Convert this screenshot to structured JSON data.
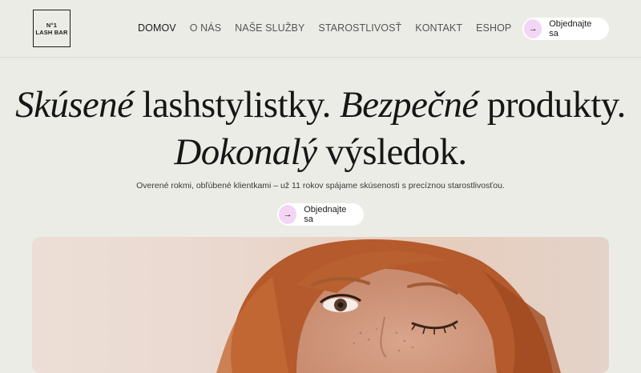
{
  "logo": {
    "line1": "N°1",
    "line2": "LASH BAR"
  },
  "nav": {
    "items": [
      {
        "label": "DOMOV",
        "active": true
      },
      {
        "label": "O NÁS"
      },
      {
        "label": "NAŠE SLUŽBY"
      },
      {
        "label": "STAROSTLIVOSŤ"
      },
      {
        "label": "KONTAKT"
      },
      {
        "label": "ESHOP"
      }
    ]
  },
  "cta": {
    "label": "Objednajte sa",
    "icon": "arrow-right-icon"
  },
  "hero": {
    "headline": {
      "w1": "Skúsené",
      "t1": " lashstylistky. ",
      "w2": "Bezpečné",
      "t2": " produkty.",
      "w3": "Dokonalý",
      "t3": " výsledok."
    },
    "subtitle": "Overené rokmi, obľúbené klientkami – už 11 rokov spájame skúsenosti s precíznou starostlivosťou.",
    "cta_label": "Objednajte sa"
  },
  "colors": {
    "background": "#ecece6",
    "accent": "#f3d6f6",
    "text": "#1b1b1b"
  }
}
